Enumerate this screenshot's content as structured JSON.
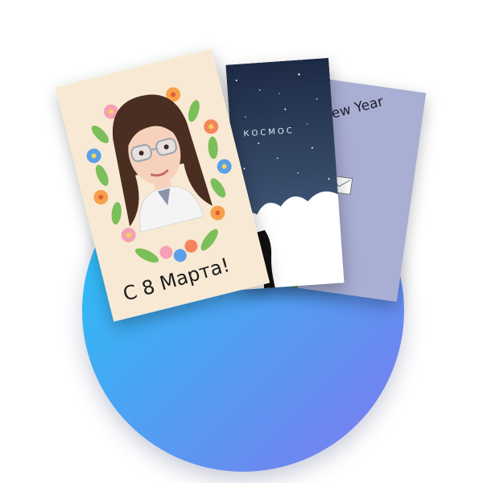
{
  "circle": {
    "gradient_start": "#1ec8f7",
    "gradient_end": "#7f79ef"
  },
  "cards": {
    "new_year": {
      "text": "New Year",
      "background": "#a9aed3"
    },
    "space": {
      "text": "КОСМОС",
      "sky_top": "#2a3a5a",
      "sky_bottom": "#4a6283"
    },
    "march8": {
      "text": "С 8 Марта!",
      "background": "#f8e9d4"
    }
  }
}
